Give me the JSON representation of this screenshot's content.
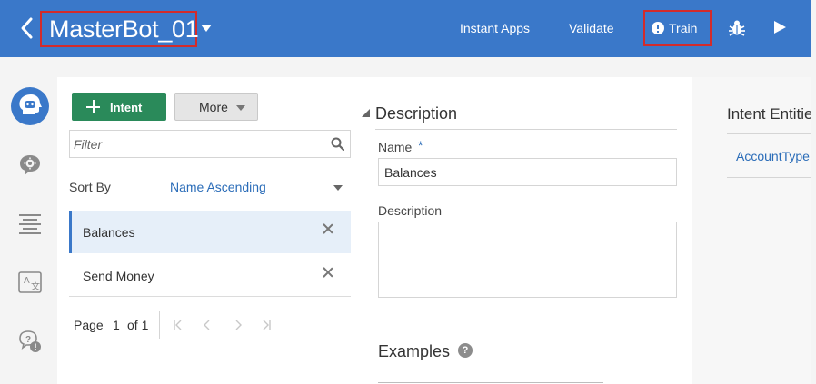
{
  "header": {
    "bot_name": "MasterBot_01",
    "nav_links": [
      "Instant Apps",
      "Validate"
    ],
    "train_label": "Train"
  },
  "rail": {
    "items": [
      {
        "name": "intents",
        "icon": "head-bot-icon",
        "active": true
      },
      {
        "name": "entities",
        "icon": "chat-gear-icon",
        "active": false
      },
      {
        "name": "flows",
        "icon": "flows-icon",
        "active": false
      },
      {
        "name": "resource-bundles",
        "icon": "translate-icon",
        "active": false
      },
      {
        "name": "q-and-a",
        "icon": "qa-icon",
        "active": false
      }
    ]
  },
  "intent_list": {
    "add_intent_label": "Intent",
    "more_label": "More",
    "filter_placeholder": "Filter",
    "sort_label": "Sort By",
    "sort_value": "Name Ascending",
    "items": [
      "Balances",
      "Send Money"
    ],
    "pager": {
      "page_label": "Page",
      "current": "1",
      "of_label": "of 1"
    }
  },
  "detail": {
    "section_title": "Description",
    "name_label": "Name",
    "required_marker": "*",
    "name_value": "Balances",
    "description_label": "Description",
    "description_value": "",
    "examples_title": "Examples",
    "help_glyph": "?"
  },
  "entities": {
    "title": "Intent Entities",
    "items": [
      "AccountType"
    ]
  },
  "colors": {
    "header_bg": "#3a78c9",
    "primary_button": "#2a8a5a",
    "link": "#2a6cb8",
    "highlight_box": "#d22b2b",
    "selected_row": "#e6eff9"
  }
}
